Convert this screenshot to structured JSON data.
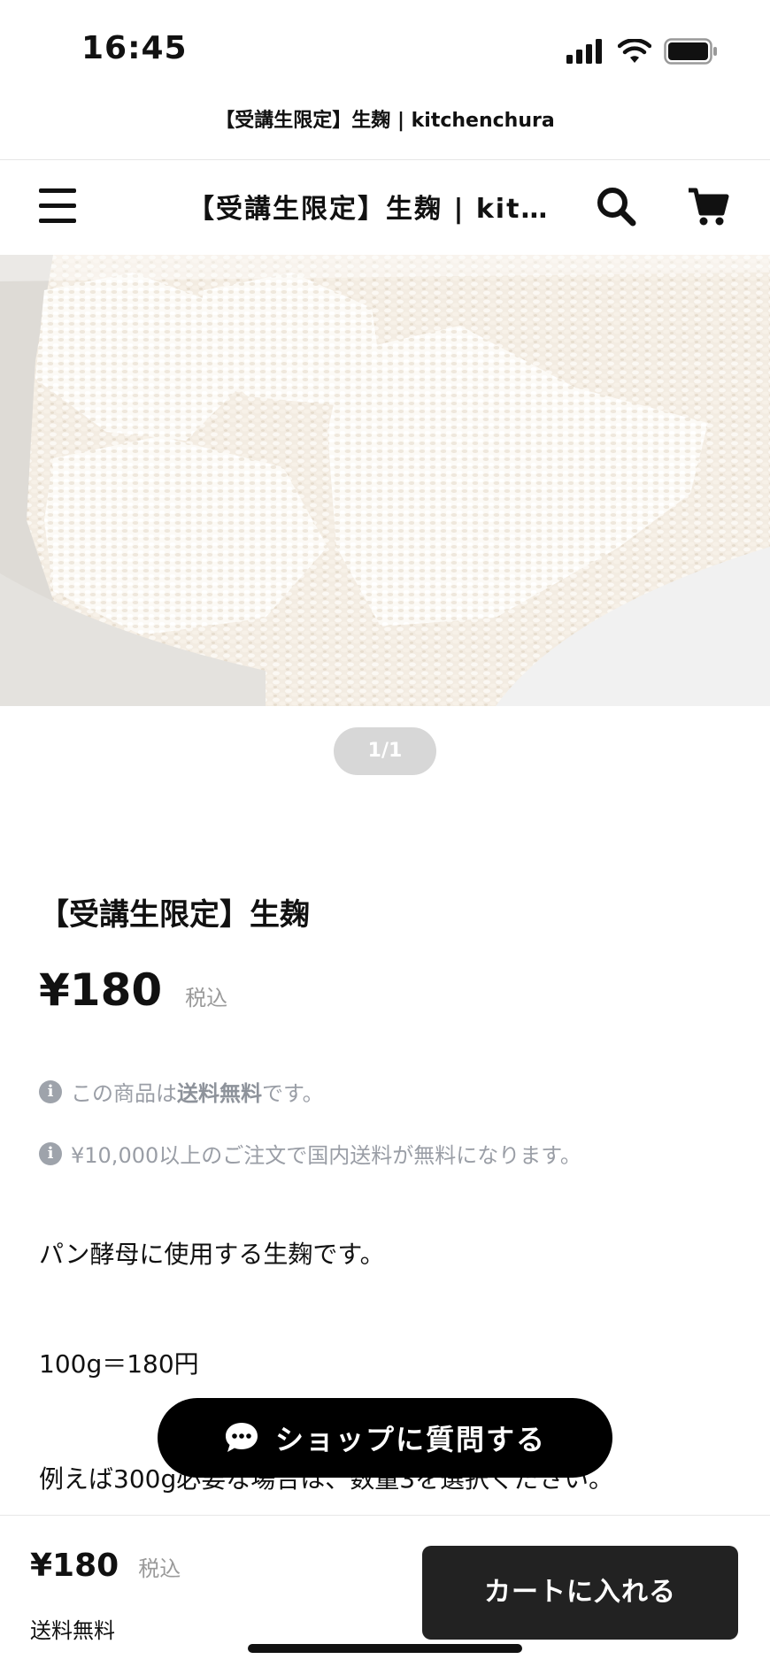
{
  "status_bar": {
    "time": "16:45",
    "icons": [
      "signal-icon",
      "wifi-icon",
      "battery-icon"
    ]
  },
  "page_tab_title": "【受講生限定】生麹 | kitchenchura",
  "header": {
    "title": "【受講生限定】生麹 | kitchenchura",
    "icons": [
      "hamburger-menu-icon",
      "search-icon",
      "cart-icon"
    ]
  },
  "gallery": {
    "pager": "1/1"
  },
  "product": {
    "name": "【受講生限定】生麹",
    "price": "¥180",
    "tax_label": "税込",
    "info_1_prefix": "この商品は",
    "info_1_bold": "送料無料",
    "info_1_suffix": "です。",
    "info_2": "¥10,000以上のご注文で国内送料が無料になります。",
    "description": [
      "パン酵母に使用する生麹です。",
      "100g＝180円",
      "例えば300g必要な場合は、数量3を選択ください。"
    ]
  },
  "ask_shop_button": "ショップに質問する",
  "bottom_bar": {
    "price": "¥180",
    "tax_label": "税込",
    "shipping": "送料無料",
    "add_to_cart": "カートに入れる"
  },
  "colors": {
    "dark_button": "#222222",
    "muted_text": "#9a9ea6",
    "pager_bg": "#d7d7d7"
  }
}
